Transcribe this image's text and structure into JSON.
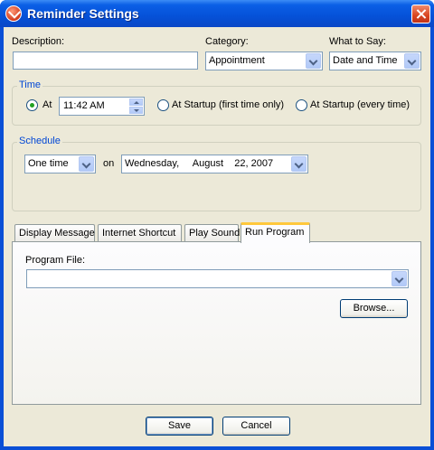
{
  "window": {
    "title": "Reminder Settings"
  },
  "description": {
    "label": "Description:",
    "value": ""
  },
  "category": {
    "label": "Category:",
    "value": "Appointment"
  },
  "what_to_say": {
    "label": "What to Say:",
    "value": "Date and Time"
  },
  "time_group": {
    "title": "Time",
    "at_label": "At",
    "time_value": "11:42 AM",
    "startup_first_label": "At Startup (first time only)",
    "startup_every_label": "At Startup (every time)"
  },
  "schedule_group": {
    "title": "Schedule",
    "frequency": "One time",
    "on_label": "on",
    "date_value": "Wednesday,     August    22, 2007"
  },
  "tabs": [
    {
      "label": "Display Message"
    },
    {
      "label": "Internet Shortcut"
    },
    {
      "label": "Play Sound"
    },
    {
      "label": "Run Program"
    }
  ],
  "run_program": {
    "program_file_label": "Program File:",
    "program_file_value": "",
    "browse_label": "Browse..."
  },
  "footer": {
    "save_label": "Save",
    "cancel_label": "Cancel"
  },
  "colors": {
    "title_bar": "#0551d8",
    "dialog_bg": "#ece9d8",
    "group_title": "#0046d5",
    "active_tab_accent": "#ffc83c"
  }
}
